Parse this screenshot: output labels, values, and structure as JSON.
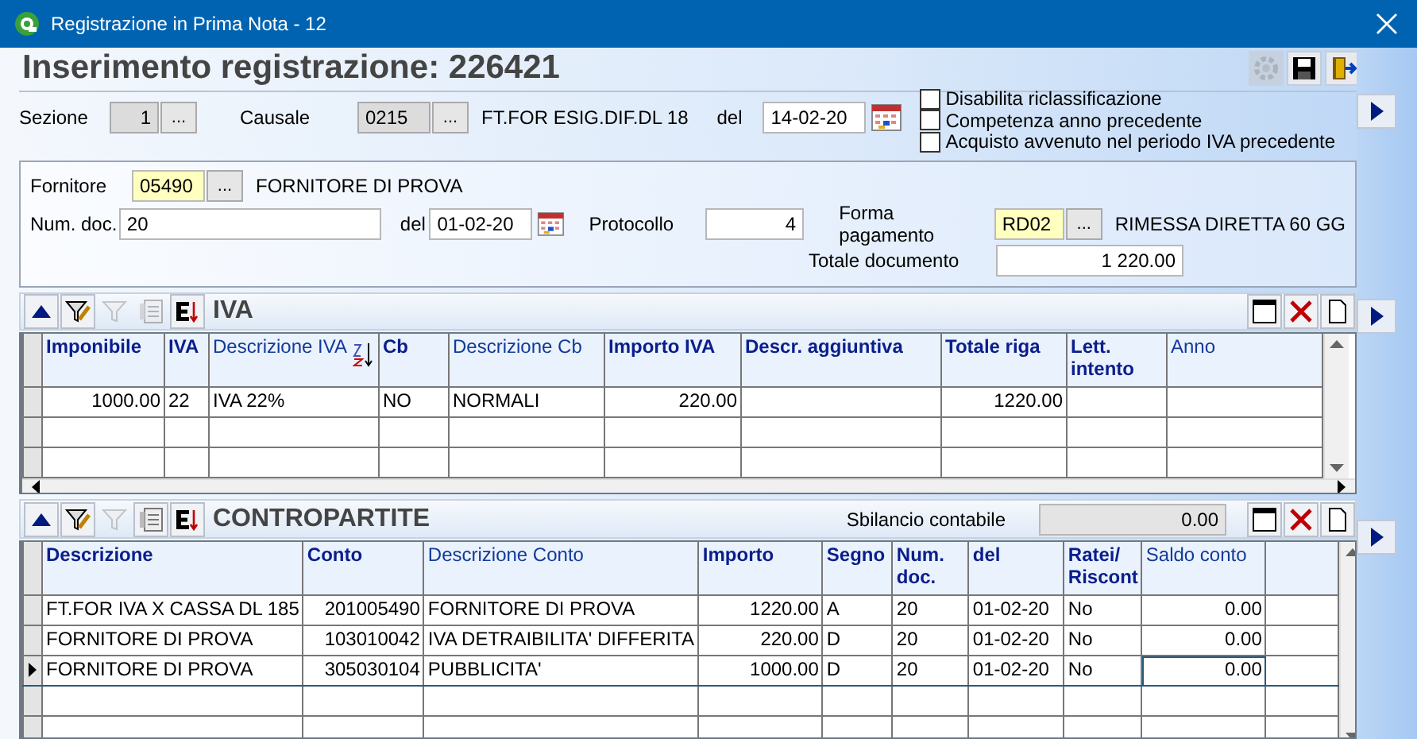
{
  "window": {
    "title": "Registrazione in Prima Nota - 12"
  },
  "header": {
    "title": "Inserimento registrazione: 226421",
    "actions": [
      {
        "kind": "settings",
        "disabled": true
      },
      {
        "kind": "save",
        "disabled": false
      },
      {
        "kind": "exit",
        "disabled": false
      }
    ]
  },
  "registration": {
    "sezione": {
      "label": "Sezione",
      "value": "1",
      "button": "..."
    },
    "causale": {
      "label": "Causale",
      "value": "0215",
      "button": "...",
      "description": "FT.FOR ESIG.DIF.DL 18"
    },
    "date": {
      "label": "del",
      "value": "14-02-20"
    },
    "options": [
      {
        "label": "Disabilita riclassificazione",
        "checked": false
      },
      {
        "label": "Competenza anno precedente",
        "checked": false
      },
      {
        "label": "Acquisto avvenuto nel periodo IVA precedente",
        "checked": false
      }
    ]
  },
  "document": {
    "fornitore": {
      "label": "Fornitore",
      "value": "05490",
      "button": "...",
      "description": "FORNITORE DI PROVA"
    },
    "num_doc": {
      "label": "Num. doc.",
      "value": "20"
    },
    "date": {
      "label": "del",
      "value": "01-02-20"
    },
    "protocollo": {
      "label": "Protocollo",
      "value": "4"
    },
    "pagamento": {
      "label": "Forma pagamento",
      "value": "RD02",
      "button": "...",
      "description": "RIMESSA DIRETTA 60 GG"
    },
    "totale": {
      "label": "Totale documento",
      "value": "1 220.00"
    }
  },
  "iva": {
    "title": "IVA",
    "tools": [
      {
        "kind": "up",
        "disabled": false
      },
      {
        "kind": "edit-filter",
        "disabled": false
      },
      {
        "kind": "filter",
        "disabled": true
      },
      {
        "kind": "list",
        "disabled": true
      },
      {
        "kind": "sort",
        "disabled": false
      }
    ],
    "columns": [
      {
        "label": "Imponibile",
        "bold": true,
        "sorted": false
      },
      {
        "label": "IVA",
        "bold": true,
        "sorted": false
      },
      {
        "label": "Descrizione IVA",
        "bold": false,
        "sorted": true
      },
      {
        "label": "Cb",
        "bold": true,
        "sorted": false
      },
      {
        "label": "Descrizione Cb",
        "bold": false,
        "sorted": false
      },
      {
        "label": "Importo IVA",
        "bold": true,
        "sorted": false
      },
      {
        "label": "Descr. aggiuntiva",
        "bold": true,
        "sorted": false
      },
      {
        "label": "Totale riga",
        "bold": true,
        "sorted": false
      },
      {
        "label": "Lett. intento",
        "bold": true,
        "sorted": false
      },
      {
        "label": "Anno",
        "bold": false,
        "sorted": false
      }
    ],
    "rows": [
      {
        "selected": false,
        "cells": [
          "1000.00",
          "22",
          "IVA 22%",
          "NO",
          "NORMALI",
          "220.00",
          null,
          "1220.00",
          null,
          null
        ]
      }
    ]
  },
  "contropartite": {
    "title": "CONTROPARTITE",
    "tools": [
      {
        "kind": "up",
        "disabled": false
      },
      {
        "kind": "edit-filter",
        "disabled": false
      },
      {
        "kind": "filter",
        "disabled": true
      },
      {
        "kind": "list",
        "disabled": false
      },
      {
        "kind": "sort",
        "disabled": false
      }
    ],
    "balance": {
      "label": "Sbilancio contabile",
      "value": "0.00"
    },
    "columns": [
      {
        "label": "Descrizione",
        "bold": true,
        "sorted": false
      },
      {
        "label": "Conto",
        "bold": true,
        "sorted": false
      },
      {
        "label": "Descrizione Conto",
        "bold": false,
        "sorted": false
      },
      {
        "label": "Importo",
        "bold": true,
        "sorted": false
      },
      {
        "label": "Segno",
        "bold": true,
        "sorted": false
      },
      {
        "label": "Num. doc.",
        "bold": true,
        "sorted": false
      },
      {
        "label": "del",
        "bold": true,
        "sorted": false
      },
      {
        "label": "Ratei/ Riscont",
        "bold": true,
        "sorted": false
      },
      {
        "label": "Saldo conto",
        "bold": false,
        "sorted": false
      }
    ],
    "rows": [
      {
        "selected": false,
        "cells": [
          "FT.FOR IVA X CASSA DL 185",
          "201005490",
          "FORNITORE DI PROVA",
          "1220.00",
          "A",
          "20",
          "01-02-20",
          "No",
          "0.00"
        ]
      },
      {
        "selected": false,
        "cells": [
          "FORNITORE DI PROVA",
          "103010042",
          "IVA DETRAIBILITA' DIFFERITA",
          "220.00",
          "D",
          "20",
          "01-02-20",
          "No",
          "0.00"
        ]
      },
      {
        "selected": true,
        "cells": [
          "FORNITORE DI PROVA",
          "305030104",
          "PUBBLICITA'",
          "1000.00",
          "D",
          "20",
          "01-02-20",
          "No",
          "0.00"
        ]
      }
    ]
  }
}
